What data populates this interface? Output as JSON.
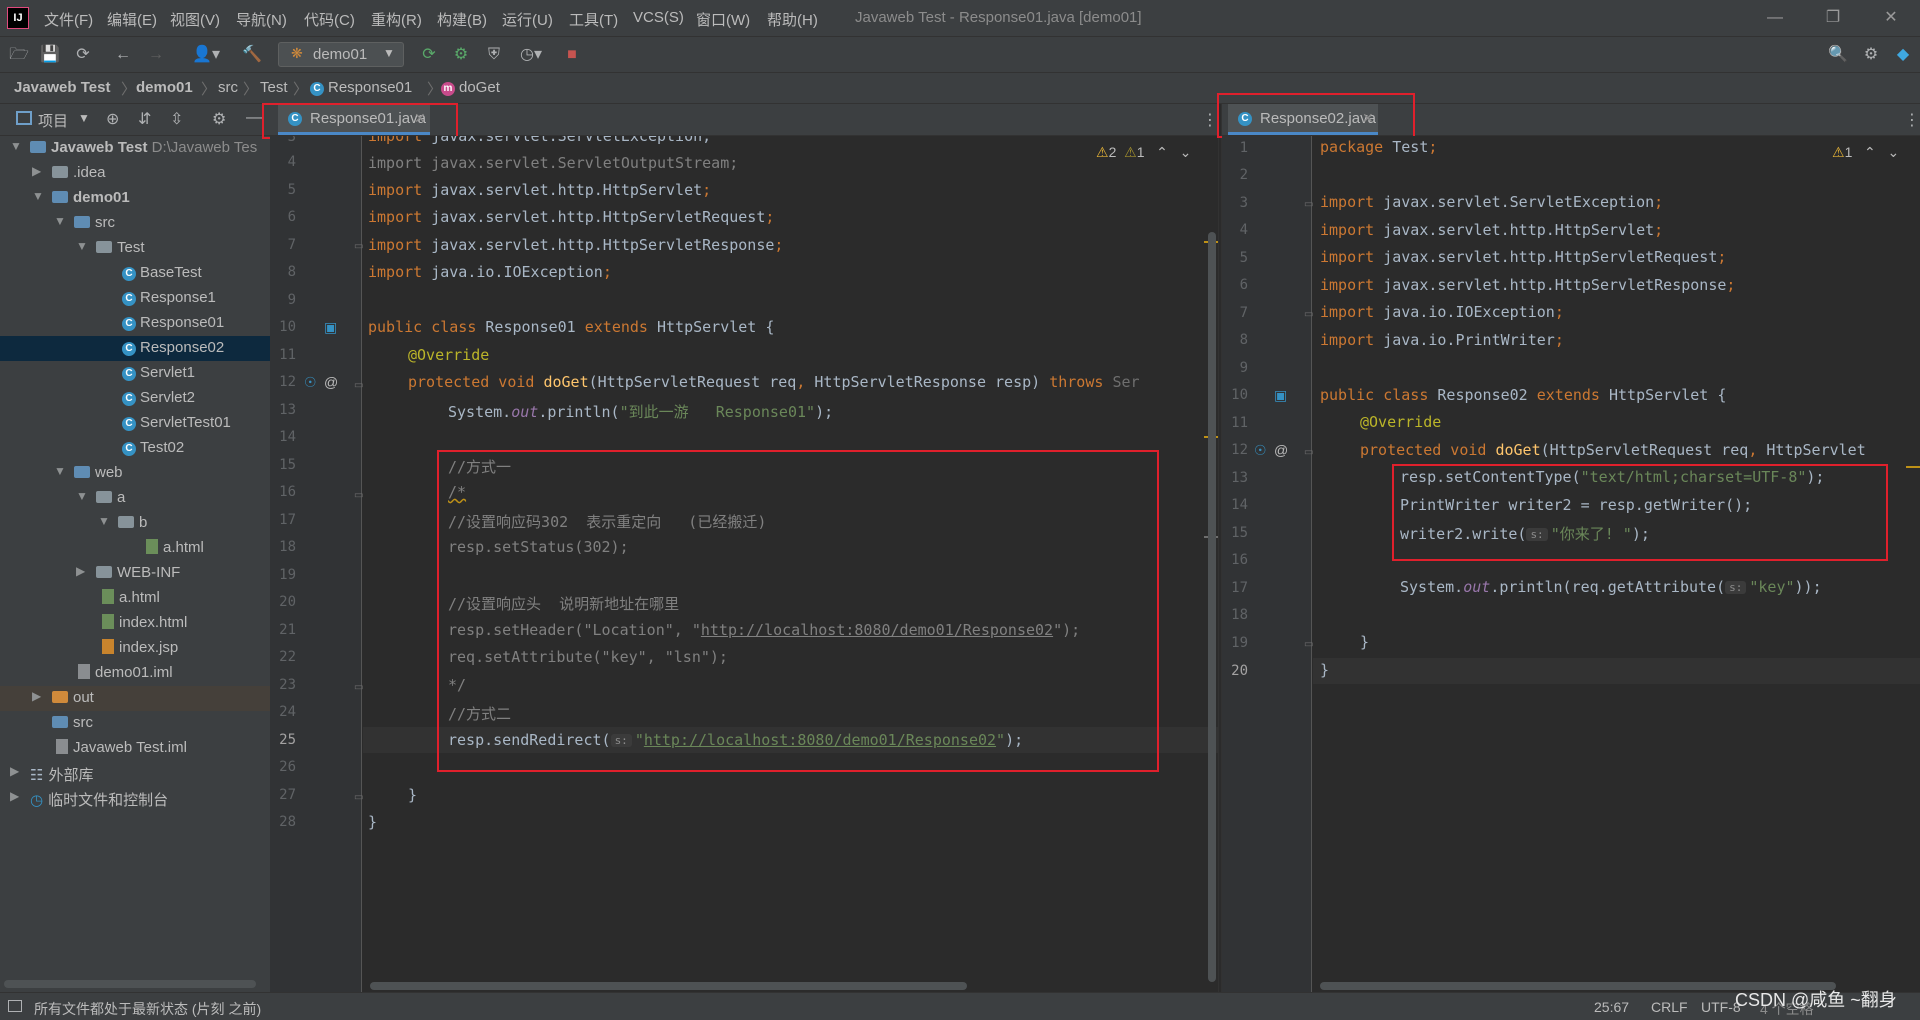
{
  "menu": [
    "文件(F)",
    "编辑(E)",
    "视图(V)",
    "导航(N)",
    "代码(C)",
    "重构(R)",
    "构建(B)",
    "运行(U)",
    "工具(T)",
    "VCS(S)",
    "窗口(W)",
    "帮助(H)"
  ],
  "window_title": "Javaweb Test - Response01.java [demo01]",
  "run_config": "demo01",
  "breadcrumb": [
    "Javaweb Test",
    "demo01",
    "src",
    "Test",
    "Response01",
    "doGet"
  ],
  "project_panel": {
    "title": "项目",
    "root_path": "D:\\Javaweb Tes",
    "tree": [
      "Javaweb Test",
      ".idea",
      "demo01",
      "src",
      "Test",
      "BaseTest",
      "Response1",
      "Response01",
      "Response02",
      "Servlet1",
      "Servlet2",
      "ServletTest01",
      "Test02",
      "web",
      "a",
      "b",
      "a.html",
      "WEB-INF",
      "a.html",
      "index.html",
      "index.jsp",
      "demo01.iml",
      "out",
      "src",
      "Javaweb Test.iml",
      "外部库",
      "临时文件和控制台"
    ]
  },
  "left_editor": {
    "tab": "Response01.java",
    "inspections": {
      "warnings": "2",
      "weak_warnings": "1"
    },
    "line_numbers": [
      "3",
      "4",
      "5",
      "6",
      "7",
      "8",
      "9",
      "10",
      "11",
      "12",
      "13",
      "14",
      "15",
      "16",
      "17",
      "18",
      "19",
      "20",
      "21",
      "22",
      "23",
      "24",
      "25",
      "26",
      "27",
      "28"
    ],
    "current_line": "25",
    "code": {
      "l3a": "import ",
      "l3b": "javax.servlet.ServletException;",
      "l4": "import javax.servlet.ServletOutputStream;",
      "l5a": "import ",
      "l5b": "javax.servlet.http.HttpServlet",
      "l5c": ";",
      "l6a": "import ",
      "l6b": "javax.servlet.http.HttpServletRequest",
      "l6c": ";",
      "l7a": "import ",
      "l7b": "javax.servlet.http.HttpServletResponse",
      "l7c": ";",
      "l8a": "import ",
      "l8b": "java.io.IOException",
      "l8c": ";",
      "l10a": "public class ",
      "l10b": "Response01 ",
      "l10c": "extends ",
      "l10d": "HttpServlet {",
      "l11": "@Override",
      "l12a": "protected void ",
      "l12b": "doGet",
      "l12c": "(HttpServletRequest req",
      "l12d": ", ",
      "l12e": "HttpServletResponse resp) ",
      "l12f": "throws ",
      "l12g": "Ser",
      "l13a": "System.",
      "l13b": "out",
      "l13c": ".println(",
      "l13d": "\"到此一游   Response01\"",
      "l13e": ");",
      "l15": "//方式一",
      "l16": "/*",
      "l17": "//设置响应码302  表示重定向   (已经搬迁)",
      "l18": "resp.setStatus(302);",
      "l20": "//设置响应头  说明新地址在哪里",
      "l21a": "resp.setHeader(\"Location\", \"",
      "l21b": "http://localhost:8080/demo01/Response02",
      "l21c": "\");",
      "l22": "req.setAttribute(\"key\", \"lsn\");",
      "l23": "*/",
      "l24": "//方式二",
      "l25a": "resp.sendRedirect(",
      "l25hint": "s:",
      "l25b": "\"",
      "l25c": "http://localhost:8080/demo01/Response02",
      "l25d": "\"",
      "l25e": ");",
      "l27": "}",
      "l28": "}"
    }
  },
  "right_editor": {
    "tab": "Response02.java",
    "inspections": {
      "warnings": "1"
    },
    "line_numbers": [
      "1",
      "2",
      "3",
      "4",
      "5",
      "6",
      "7",
      "8",
      "9",
      "10",
      "11",
      "12",
      "13",
      "14",
      "15",
      "16",
      "17",
      "18",
      "19",
      "20"
    ],
    "current_line": "20",
    "code": {
      "l1a": "package ",
      "l1b": "Test",
      "l1c": ";",
      "l3a": "import ",
      "l3b": "javax.servlet.ServletException",
      "l3c": ";",
      "l4a": "import ",
      "l4b": "javax.servlet.http.HttpServlet",
      "l4c": ";",
      "l5a": "import ",
      "l5b": "javax.servlet.http.HttpServletRequest",
      "l5c": ";",
      "l6a": "import ",
      "l6b": "javax.servlet.http.HttpServletResponse",
      "l6c": ";",
      "l7a": "import ",
      "l7b": "java.io.IOException",
      "l7c": ";",
      "l8a": "import ",
      "l8b": "java.io.PrintWriter",
      "l8c": ";",
      "l10a": "public class ",
      "l10b": "Response02 ",
      "l10c": "extends ",
      "l10d": "HttpServlet {",
      "l11": "@Override",
      "l12a": "protected void ",
      "l12b": "doGet",
      "l12c": "(HttpServletRequest req",
      "l12d": ", ",
      "l12e": "HttpServlet",
      "l13a": "resp.setContentType(",
      "l13b": "\"text/html;charset=UTF-8\"",
      "l13c": ");",
      "l14": "PrintWriter writer2 = resp.getWriter();",
      "l15a": "writer2.write(",
      "l15hint": "s:",
      "l15b": "\"你来了! \"",
      "l15c": ");",
      "l17a": "System.",
      "l17b": "out",
      "l17c": ".println(req.getAttribute(",
      "l17hint": "s:",
      "l17d": "\"key\"",
      "l17e": "));",
      "l19": "}",
      "l20": "}"
    }
  },
  "status": {
    "message": "所有文件都处于最新状态 (片刻 之前)",
    "position": "25:67",
    "line_sep": "CRLF",
    "encoding": "UTF-8",
    "indent": "4 个空格"
  },
  "watermark": "CSDN @咸鱼 ~翻身"
}
